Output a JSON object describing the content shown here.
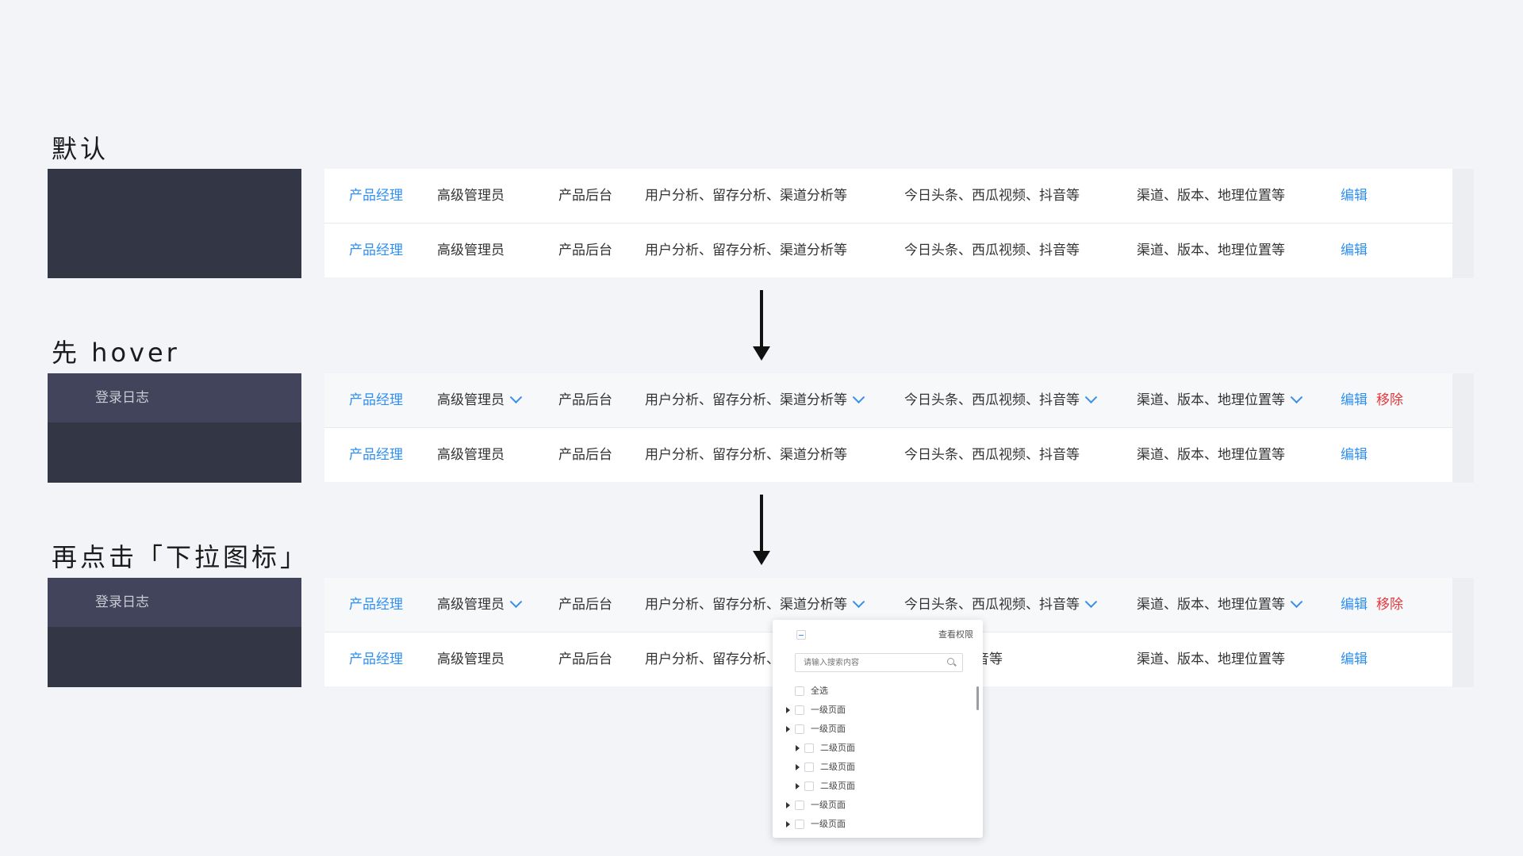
{
  "stages": [
    {
      "title": "默认"
    },
    {
      "title": "先 hover"
    },
    {
      "title": "再点击「下拉图标」"
    }
  ],
  "sidebar": {
    "hover_item": "登录日志"
  },
  "row": {
    "name": "产品经理",
    "role": "高级管理员",
    "backend": "产品后台",
    "analytics": "用户分析、留存分析、渠道分析等",
    "apps": "今日头条、西瓜视频、抖音等",
    "dims": "渠道、版本、地理位置等",
    "edit": "编辑",
    "remove": "移除",
    "analytics_partial": "用户分析、留存分析、",
    "apps_partial": "瓜视频、抖音等"
  },
  "dropdown": {
    "view_permissions": "查看权限",
    "search_placeholder": "请输入搜索内容",
    "select_all": "全选",
    "items": [
      {
        "label": "一级页面",
        "level": 1
      },
      {
        "label": "一级页面",
        "level": 1
      },
      {
        "label": "二级页面",
        "level": 2
      },
      {
        "label": "二级页面",
        "level": 2
      },
      {
        "label": "二级页面",
        "level": 2
      },
      {
        "label": "一级页面",
        "level": 1
      },
      {
        "label": "一级页面",
        "level": 1
      }
    ]
  },
  "colors": {
    "link": "#2f8ff0",
    "danger": "#e0393e",
    "sidebar": "#333644",
    "sidebar_hover": "#41445a",
    "background": "#f2f4f7"
  }
}
